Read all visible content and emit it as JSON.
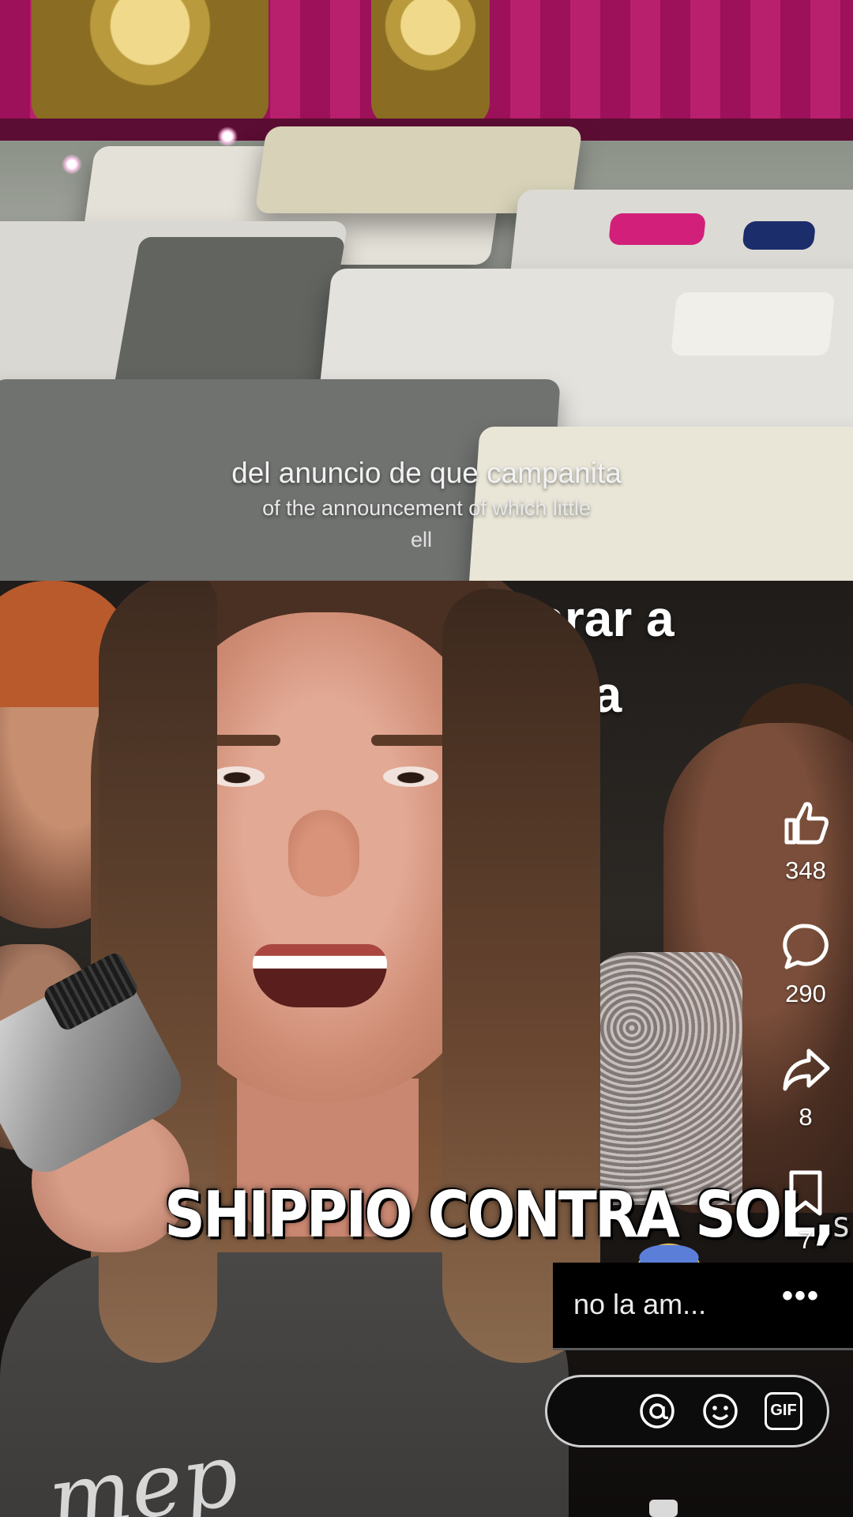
{
  "top_video": {
    "caption_es": "del anuncio de que campanita",
    "caption_en": "of the announcement of which little",
    "caption_en_cont": "ell"
  },
  "bottom_video": {
    "title_line1": "Yi                  ncarar a",
    "title_line2": "                        za",
    "subtitle": "SHIPPIO CONTRA SOL,",
    "subtitle_tail": "s",
    "shirt_print": "mep"
  },
  "actions": {
    "likes": "348",
    "comments": "290",
    "shares": "8",
    "saves": "7"
  },
  "description": {
    "text": "no la am...",
    "more": "•••"
  },
  "comment_bar": {
    "icons": [
      "at-icon",
      "emoji-icon",
      "gif-icon"
    ],
    "gif_label": "GIF",
    "at_label": "@"
  },
  "colors": {
    "wall_magenta": "#a01a5c",
    "background": "#0d0b0d",
    "accent": "#ffffff"
  }
}
